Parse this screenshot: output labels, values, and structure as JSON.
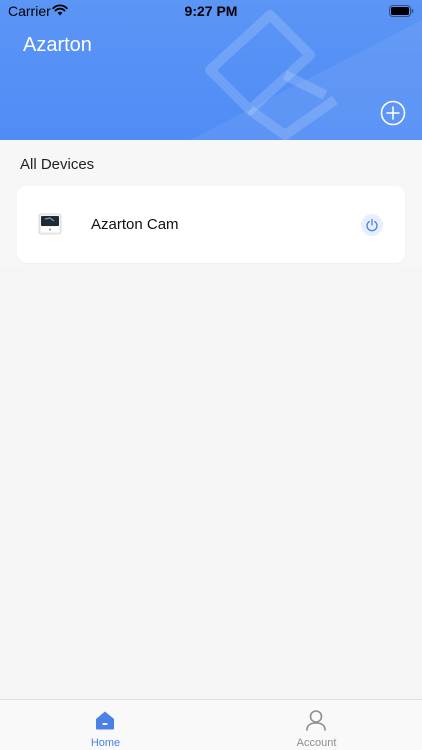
{
  "status_bar": {
    "carrier": "Carrier",
    "time": "9:27 PM",
    "icons": [
      "wifi-icon",
      "battery-icon"
    ]
  },
  "header": {
    "title": "Azarton",
    "add_icon": "plus-circle-icon",
    "background_color": "#5b95f5"
  },
  "devices": {
    "section_title": "All Devices",
    "items": [
      {
        "name": "Azarton Cam",
        "thumb_icon": "camera-device-icon",
        "action_icon": "power-icon"
      }
    ]
  },
  "tabbar": {
    "tabs": [
      {
        "label": "Home",
        "icon": "home-icon",
        "active": true,
        "color": "#4a80e8"
      },
      {
        "label": "Account",
        "icon": "person-icon",
        "active": false,
        "color": "#8e8e93"
      }
    ]
  }
}
